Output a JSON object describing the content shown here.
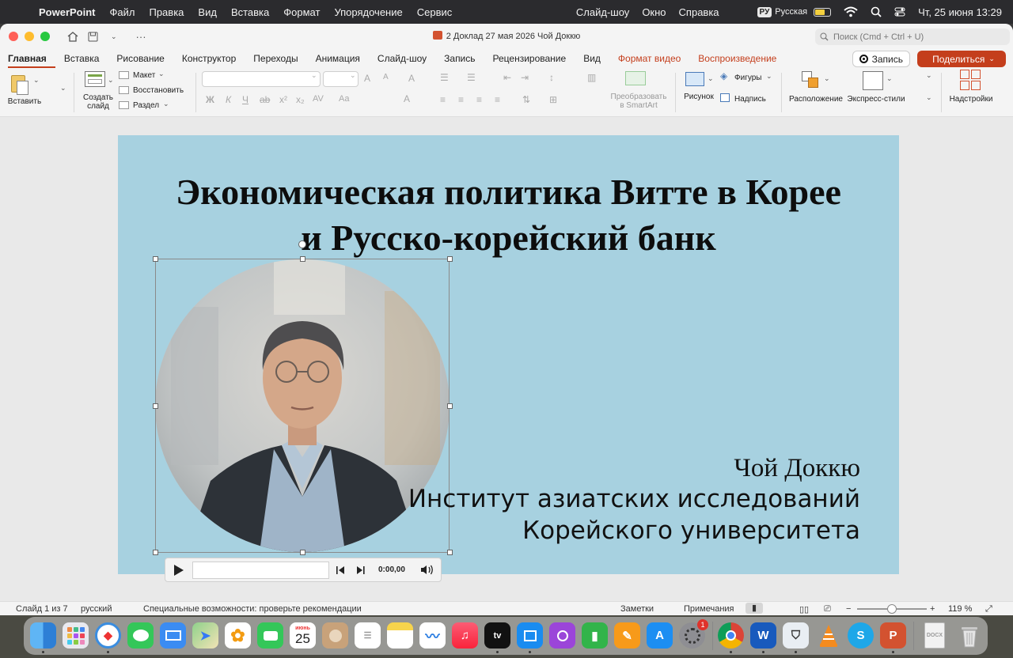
{
  "menubar": {
    "items": [
      "PowerPoint",
      "Файл",
      "Правка",
      "Вид",
      "Вставка",
      "Формат",
      "Упорядочение",
      "Сервис"
    ],
    "right_items": [
      "Слайд-шоу",
      "Окно",
      "Справка"
    ],
    "input_badge": "РУ",
    "input_lang": "Русская",
    "datetime": "Чт, 25 июня  13:29"
  },
  "window": {
    "doc_title": "2 Доклад 27 мая 2026 Чой Доккю",
    "search_placeholder": "Поиск (Cmd + Ctrl + U)"
  },
  "ribbon": {
    "tabs": [
      "Главная",
      "Вставка",
      "Рисование",
      "Конструктор",
      "Переходы",
      "Анимация",
      "Слайд-шоу",
      "Запись",
      "Рецензирование",
      "Вид",
      "Формат видео",
      "Воспроизведение"
    ],
    "active_tab": "Главная",
    "record_label": "Запись",
    "share_label": "Поделиться",
    "paste": "Вставить",
    "new_slide": "Создать слайд",
    "layout": "Макет",
    "reset": "Восстановить",
    "section": "Раздел",
    "smartart": "Преобразовать в SmartArt",
    "picture": "Рисунок",
    "shapes": "Фигуры",
    "textbox": "Надпись",
    "arrange": "Расположение",
    "quick_styles": "Экспресс-стили",
    "addins": "Надстройки"
  },
  "slide": {
    "title_line1": "Экономическая политика Витте в Корее",
    "title_line2": "и Русско-корейский банк",
    "author_name": "Чой Доккю",
    "institute_line1": "Институт азиатских исследований",
    "institute_line2": "Корейского университета",
    "background_color": "#a7d1e0"
  },
  "media_player": {
    "time": "0:00,00",
    "progress": 0
  },
  "statusbar": {
    "slide_info": "Слайд 1 из 7",
    "language": "русский",
    "accessibility": "Специальные возможности: проверьте рекомендации",
    "notes": "Заметки",
    "comments": "Примечания",
    "zoom": "119 %"
  },
  "dock": {
    "calendar_month": "июнь",
    "calendar_day": "25",
    "settings_badge": "1",
    "apps": [
      "finder-icon",
      "launchpad-icon",
      "safari-icon",
      "messages-icon",
      "mail-icon",
      "maps-icon",
      "photos-icon",
      "facetime-icon",
      "calendar-icon",
      "contacts-icon",
      "reminders-icon",
      "notes-icon",
      "freeform-icon",
      "music-icon",
      "tv-icon",
      "keynote-icon",
      "podcasts-icon",
      "numbers-icon",
      "pages-icon",
      "app-store-icon",
      "system-settings-icon",
      "chrome-icon",
      "word-icon",
      "shield-app-icon",
      "vlc-icon",
      "skype-icon",
      "powerpoint-icon",
      "document-icon",
      "trash-icon"
    ]
  }
}
